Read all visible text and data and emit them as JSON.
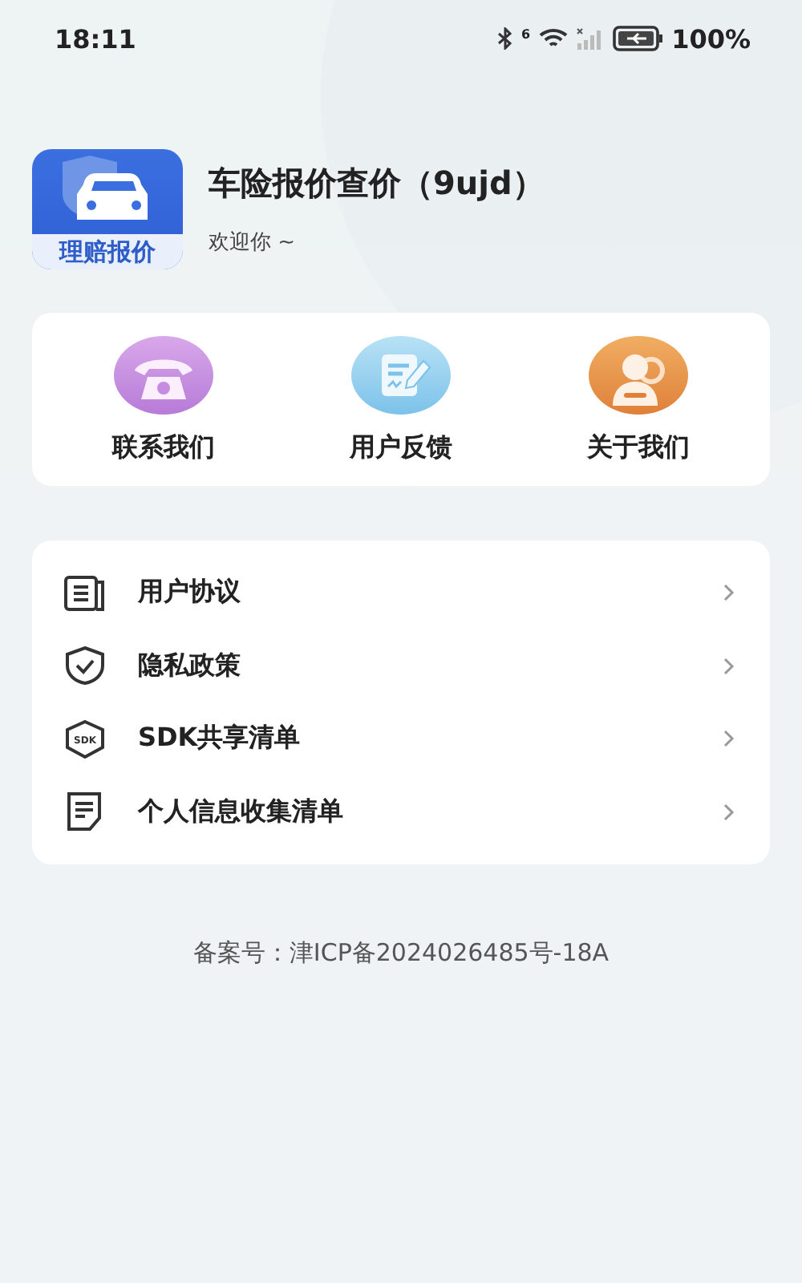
{
  "status_bar": {
    "time": "18:11",
    "signal_superscript": "6",
    "battery": "100%"
  },
  "app": {
    "logo_caption": "理赔报价",
    "title": "车险报价查价（9ujd）",
    "subtitle": "欢迎你 ~"
  },
  "quick_actions": [
    {
      "kind": "phone",
      "label": "联系我们"
    },
    {
      "kind": "feedback",
      "label": "用户反馈"
    },
    {
      "kind": "about",
      "label": "关于我们"
    }
  ],
  "menu": [
    {
      "kind": "document",
      "label": "用户协议"
    },
    {
      "kind": "shield",
      "label": "隐私政策"
    },
    {
      "kind": "sdk",
      "label": "SDK共享清单",
      "icon_text": "SDK"
    },
    {
      "kind": "form",
      "label": "个人信息收集清单"
    }
  ],
  "footer": "备案号：津ICP备2024026485号-18A"
}
